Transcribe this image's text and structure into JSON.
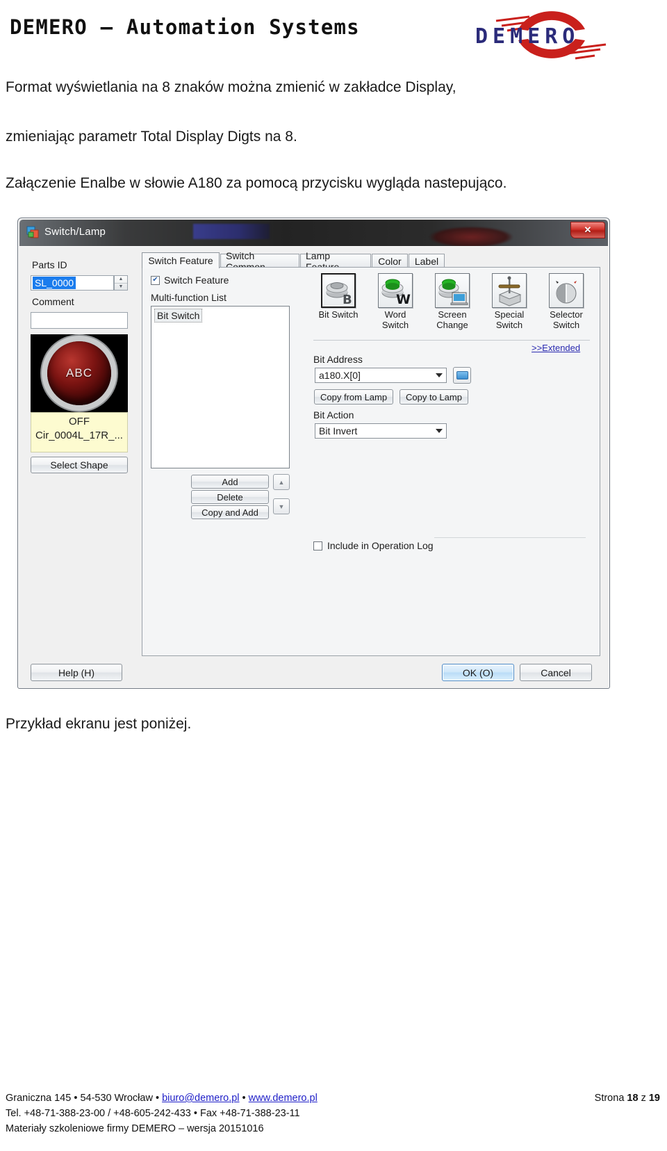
{
  "header": {
    "brand_title": "DEMERO – Automation Systems",
    "logo_text": "DEMERO"
  },
  "document": {
    "paragraph_1": "Format wyświetlania na 8 znaków można zmienić w zakładce Display,",
    "paragraph_2": "zmieniając parametr Total Display Digts na 8.",
    "paragraph_3": "Załączenie Enalbe w słowie A180 za pomocą przycisku wygląda nastepująco.",
    "paragraph_4": "Przykład ekranu jest poniżej."
  },
  "dialog": {
    "title": "Switch/Lamp",
    "close_label": "✕",
    "left": {
      "parts_id_label": "Parts ID",
      "parts_id_value": "SL_0000",
      "comment_label": "Comment",
      "comment_value": "",
      "preview_caption": "ABC",
      "state_label": "OFF",
      "shape_name": "Cir_0004L_17R_...",
      "select_shape_label": "Select Shape",
      "help_label": "Help (H)"
    },
    "tabs": [
      {
        "label": "Switch Feature",
        "active": true
      },
      {
        "label": "Switch Common",
        "active": false
      },
      {
        "label": "Lamp Feature",
        "active": false
      },
      {
        "label": "Color",
        "active": false
      },
      {
        "label": "Label",
        "active": false
      }
    ],
    "panel": {
      "switch_feature_checkbox_label": "Switch Feature",
      "switch_feature_checked": true,
      "multi_function_list_label": "Multi-function List",
      "list_items": [
        "Bit Switch"
      ],
      "add_label": "Add",
      "delete_label": "Delete",
      "copy_and_add_label": "Copy and Add",
      "switch_types": [
        {
          "label_line1": "Bit Switch",
          "label_line2": "",
          "selected": true
        },
        {
          "label_line1": "Word",
          "label_line2": "Switch",
          "selected": false
        },
        {
          "label_line1": "Screen",
          "label_line2": "Change",
          "selected": false
        },
        {
          "label_line1": "Special",
          "label_line2": "Switch",
          "selected": false
        },
        {
          "label_line1": "Selector",
          "label_line2": "Switch",
          "selected": false
        }
      ],
      "extended_link": ">>Extended",
      "bit_address_label": "Bit Address",
      "bit_address_value": "a180.X[0]",
      "copy_from_lamp_label": "Copy from Lamp",
      "copy_to_lamp_label": "Copy to Lamp",
      "bit_action_label": "Bit Action",
      "bit_action_value": "Bit Invert",
      "include_log_label": "Include in Operation Log",
      "include_log_checked": false
    },
    "ok_label": "OK (O)",
    "cancel_label": "Cancel"
  },
  "footer": {
    "line1_a": "Graniczna 145 • 54-530 Wrocław • ",
    "line1_email": "biuro@demero.pl",
    "line1_b": " • ",
    "line1_web": "www.demero.pl",
    "line2": "Tel. +48-71-388-23-00 / +48-605-242-433 • Fax +48-71-388-23-11",
    "line3": "Materiały szkoleniowe firmy DEMERO – wersja 20151016",
    "page_prefix": "Strona ",
    "page_current": "18",
    "page_mid": " z ",
    "page_total": "19"
  },
  "colors": {
    "link": "#2121c8",
    "accent_blue": "#1a7ced",
    "logo_blue": "#2b2b7a",
    "logo_red": "#c9201c"
  }
}
